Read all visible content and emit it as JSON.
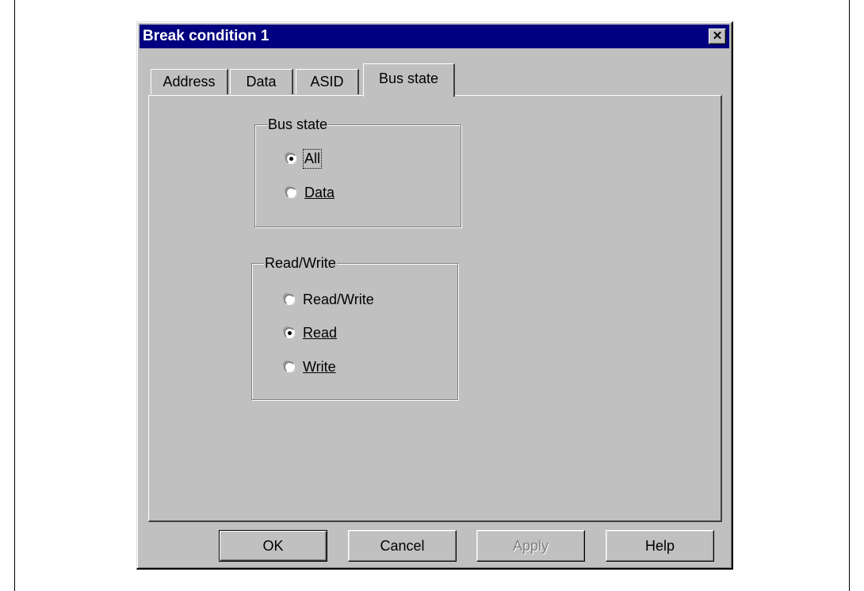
{
  "dialog": {
    "title": "Break condition 1",
    "close_symbol": "✕"
  },
  "tabs": [
    {
      "label": "Address",
      "active": false
    },
    {
      "label": "Data",
      "active": false
    },
    {
      "label": "ASID",
      "active": false
    },
    {
      "label": "Bus state",
      "active": true
    }
  ],
  "bus_state_group": {
    "legend": "Bus state",
    "options": [
      {
        "label": "All",
        "checked": true,
        "focused": true
      },
      {
        "label": "Data",
        "checked": false
      }
    ]
  },
  "read_write_group": {
    "legend": "Read/Write",
    "options": [
      {
        "label": "Read/Write",
        "checked": false
      },
      {
        "label": "Read",
        "checked": true
      },
      {
        "label": "Write",
        "checked": false
      }
    ]
  },
  "buttons": {
    "ok": "OK",
    "cancel": "Cancel",
    "apply": "Apply",
    "help": "Help"
  }
}
